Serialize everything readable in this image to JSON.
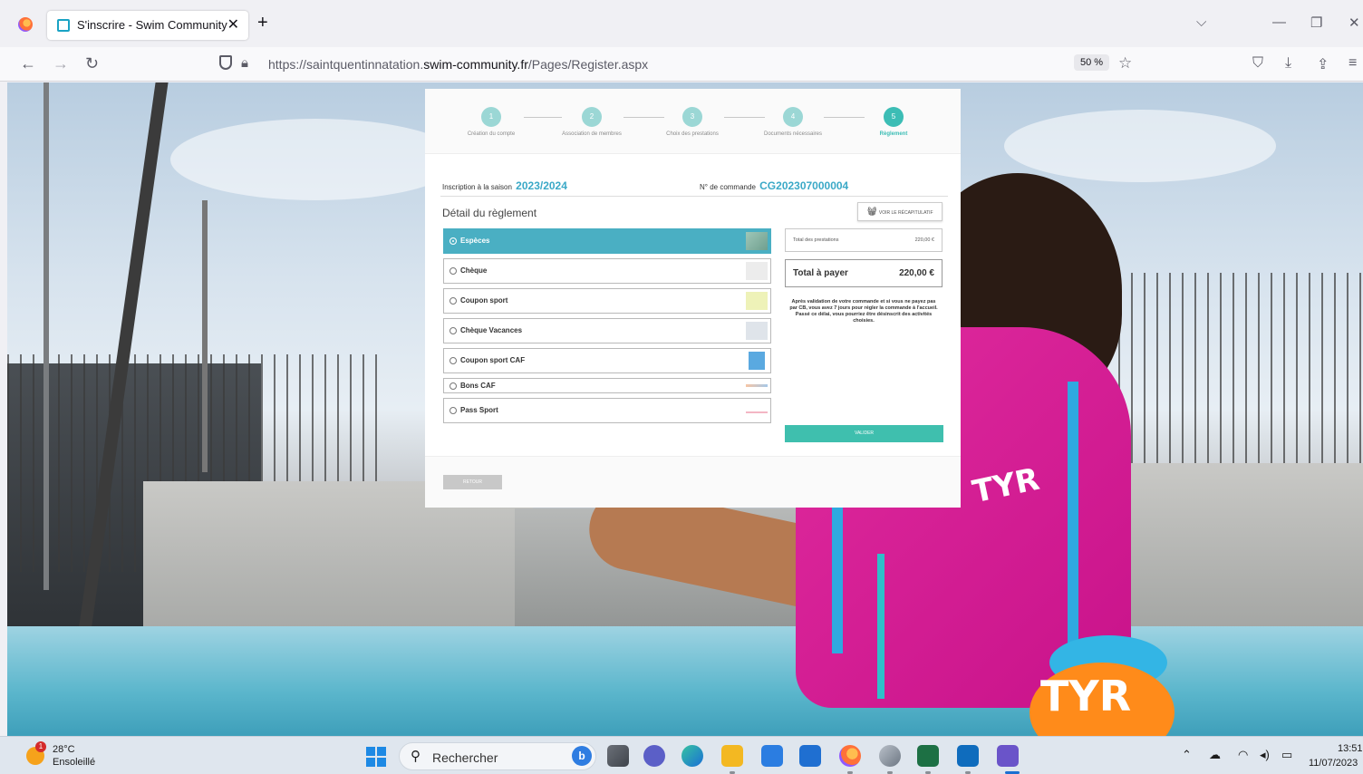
{
  "browser": {
    "tab_title": "S'inscrire - Swim Community",
    "tab_close": "✕",
    "new_tab": "+",
    "url_prefix": "https://saintquentinnatation.",
    "url_domain": "swim-community.fr",
    "url_path": "/Pages/Register.aspx",
    "zoom": "50 %"
  },
  "steps": [
    {
      "number": "1",
      "label": "Création du compte"
    },
    {
      "number": "2",
      "label": "Association de membres"
    },
    {
      "number": "3",
      "label": "Choix des prestations"
    },
    {
      "number": "4",
      "label": "Documents nécessaires"
    },
    {
      "number": "5",
      "label": "Règlement"
    }
  ],
  "order": {
    "saison_label": "Inscription à la saison",
    "saison_value": "2023/2024",
    "commande_label": "N° de commande",
    "commande_value": "CG202307000004"
  },
  "payment": {
    "title": "Détail du règlement",
    "recap_button": "VOIR LE RÉCAPITULATIF",
    "options": [
      {
        "label": "Espèces",
        "selected": true
      },
      {
        "label": "Chèque",
        "selected": false
      },
      {
        "label": "Coupon sport",
        "selected": false
      },
      {
        "label": "Chèque Vacances",
        "selected": false
      },
      {
        "label": "Coupon sport CAF",
        "selected": false
      },
      {
        "label": "Bons CAF",
        "selected": false
      },
      {
        "label": "Pass Sport",
        "selected": false
      }
    ],
    "total_prestations_label": "Total des prestations",
    "total_prestations_value": "220,00 €",
    "total_payer_label": "Total à payer",
    "total_payer_value": "220,00 €",
    "notice": "Après validation de votre commande et si vous ne payez pas par CB, vous avez 7 jours pour régler la commande à l'accueil. Passé ce délai, vous pourriez être désinscrit des activités choisies.",
    "valider_button": "VALIDER",
    "retour_button": "RETOUR"
  },
  "taskbar": {
    "weather_temp": "28°C",
    "weather_condition": "Ensoleillé",
    "weather_badge": "1",
    "search_placeholder": "Rechercher",
    "clock_time": "13:51",
    "clock_date": "11/07/2023"
  },
  "colors": {
    "accent_teal": "#3cbdb5",
    "selected_option": "#4aafc3",
    "link_blue": "#3ba9c7",
    "valider_green": "#3fbfae"
  }
}
